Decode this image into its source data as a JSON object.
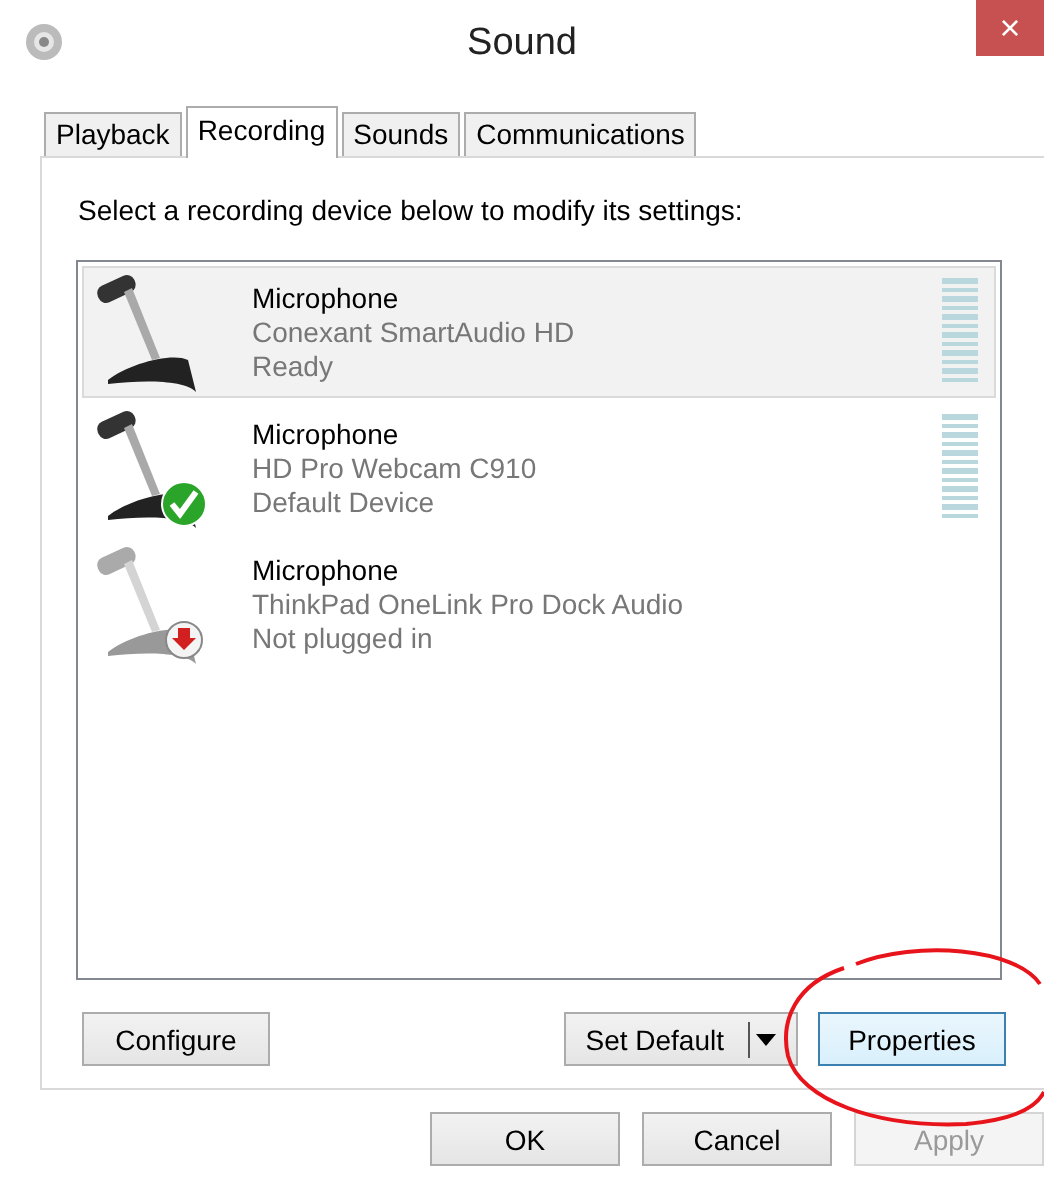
{
  "window": {
    "title": "Sound",
    "close_label": "×"
  },
  "tabs": [
    {
      "label": "Playback",
      "selected": false
    },
    {
      "label": "Recording",
      "selected": true
    },
    {
      "label": "Sounds",
      "selected": false
    },
    {
      "label": "Communications",
      "selected": false
    }
  ],
  "instruction": "Select a recording device below to modify its settings:",
  "devices": [
    {
      "name": "Microphone",
      "description": "Conexant SmartAudio HD",
      "status": "Ready",
      "selected": true,
      "plugged_in": true,
      "kind": "ready",
      "meter": true
    },
    {
      "name": "Microphone",
      "description": "HD Pro Webcam C910",
      "status": "Default Device",
      "selected": false,
      "plugged_in": true,
      "kind": "default",
      "meter": true
    },
    {
      "name": "Microphone",
      "description": "ThinkPad OneLink Pro Dock Audio",
      "status": "Not plugged in",
      "selected": false,
      "plugged_in": false,
      "kind": "unplugged",
      "meter": false
    }
  ],
  "panel_buttons": [
    {
      "label": "Configure",
      "kind": "plain",
      "focused": false
    },
    {
      "label": "Set Default",
      "kind": "split",
      "focused": false
    },
    {
      "label": "Properties",
      "kind": "plain",
      "focused": true
    }
  ],
  "dialog_buttons": [
    {
      "label": "OK",
      "disabled": false
    },
    {
      "label": "Cancel",
      "disabled": false
    },
    {
      "label": "Apply",
      "disabled": true
    }
  ]
}
